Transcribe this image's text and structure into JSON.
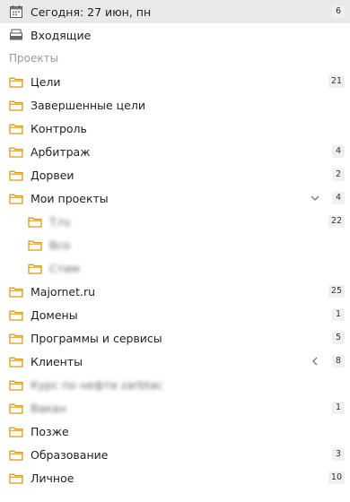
{
  "header": {
    "today_label": "Сегодня: 27 июн, пн",
    "today_count": "6",
    "inbox_label": "Входящие"
  },
  "projects_section": {
    "title": "Проекты"
  },
  "projects": [
    {
      "label": "Цели",
      "count": "21"
    },
    {
      "label": "Завершенные цели",
      "count": ""
    },
    {
      "label": "Контроль",
      "count": ""
    },
    {
      "label": "Арбитраж",
      "count": "4"
    },
    {
      "label": "Дорвеи",
      "count": "2"
    },
    {
      "label": "Мои проекты",
      "count": "4",
      "chevron": "chevron-down"
    },
    {
      "label": "T.ru",
      "count": "22",
      "child": true,
      "blurred": true
    },
    {
      "label": "Всо",
      "count": "",
      "child": true,
      "blurred": true
    },
    {
      "label": "Стим",
      "count": "",
      "child": true,
      "blurred": true
    },
    {
      "label": "Majornet.ru",
      "count": "25"
    },
    {
      "label": "Домены",
      "count": "1"
    },
    {
      "label": "Программы и сервисы",
      "count": "5"
    },
    {
      "label": "Клиенты",
      "count": "8",
      "chevron": "chevron-left"
    },
    {
      "label": "Курс по нефти zarbtac",
      "count": "",
      "blurred": true
    },
    {
      "label": "Вакан",
      "count": "1",
      "blurred": true
    },
    {
      "label": "Позже",
      "count": ""
    },
    {
      "label": "Образование",
      "count": "3"
    },
    {
      "label": "Личное",
      "count": "10"
    }
  ],
  "colors": {
    "selected_bg": "#e9e9e9",
    "folder_stroke": "#d89a1e",
    "section_text": "#9a9a9a"
  }
}
